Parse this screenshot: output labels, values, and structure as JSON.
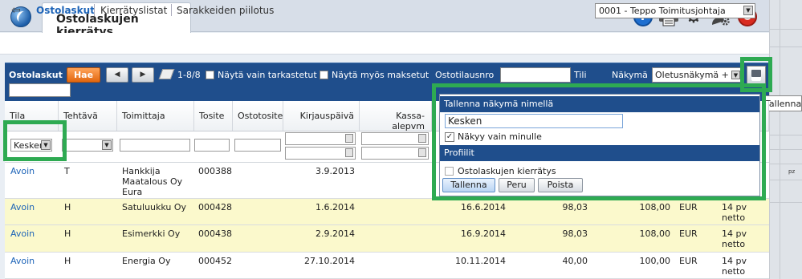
{
  "app": {
    "tab_title": "Ostolaskujen kierrätys",
    "help": "?",
    "power": "⏻"
  },
  "nav": {
    "links": [
      "Ostolaskut",
      "Kierrätyslistat",
      "Sarakkeiden piilotus"
    ],
    "user": "0001 - Teppo Toimitusjohtaja"
  },
  "toolbar": {
    "title": "Ostolaskut",
    "search_button": "Hae",
    "prev": "◀",
    "next": "▶",
    "range": "1-8/8",
    "check1": "Näytä vain tarkastetut",
    "check2": "Näytä myös maksetut",
    "order_label": "Ostotilausnro",
    "order_value": "",
    "tili_label": "Tili",
    "view_label": "Näkymä",
    "view_value": "Oletusnäkymä +",
    "save_tooltip": "Tallenna"
  },
  "table": {
    "headers": [
      "Tila",
      "Tehtävä",
      "Toimittaja",
      "Tosite",
      "Ostotosite",
      "Kirjauspäivä",
      "Kassa-alepvm"
    ],
    "filter_tila": "Kesken",
    "rows": [
      {
        "tila": "Avoin",
        "tehtava": "T",
        "toimittaja": [
          "Hankkija",
          "Maatalous Oy",
          "Eura"
        ],
        "tosite": "000388",
        "ostotosite": "",
        "kirjaus": "3.9.2013",
        "kassa": "",
        "erapvm": "",
        "summa1": "",
        "summa2": "",
        "valuutta": "",
        "ehto": []
      },
      {
        "tila": "Avoin",
        "tehtava": "H",
        "toimittaja": [
          "Satuluukku Oy"
        ],
        "tosite": "000428",
        "ostotosite": "",
        "kirjaus": "1.6.2014",
        "kassa": "",
        "erapvm": "16.6.2014",
        "summa1": "98,03",
        "summa2": "108,00",
        "valuutta": "EUR",
        "ehto": [
          "14 pv",
          "netto"
        ]
      },
      {
        "tila": "Avoin",
        "tehtava": "H",
        "toimittaja": [
          "Esimerkki Oy"
        ],
        "tosite": "000438",
        "ostotosite": "",
        "kirjaus": "2.9.2014",
        "kassa": "",
        "erapvm": "16.9.2014",
        "summa1": "98,03",
        "summa2": "108,00",
        "valuutta": "EUR",
        "ehto": [
          "14 pv",
          "netto"
        ]
      },
      {
        "tila": "Avoin",
        "tehtava": "H",
        "toimittaja": [
          "Energia Oy"
        ],
        "tosite": "000452",
        "ostotosite": "",
        "kirjaus": "27.10.2014",
        "kassa": "",
        "erapvm": "10.11.2014",
        "summa1": "40,00",
        "summa2": "100,00",
        "valuutta": "EUR",
        "ehto": [
          "14 pv",
          "netto"
        ]
      }
    ]
  },
  "popup": {
    "save_header": "Tallenna näkymä nimellä",
    "name_value": "Kesken",
    "only_me": "Näkyy vain minulle",
    "profiles_header": "Profiilit",
    "profile_item": "Ostolaskujen kierrätys",
    "btn_save": "Tallenna",
    "btn_cancel": "Peru",
    "btn_delete": "Poista"
  },
  "side": {
    "snippet1": "pz"
  },
  "colors": {
    "header_blue": "#1f4e8c",
    "highlight_green": "#2eaa52",
    "row_yellow": "#fbf9cc",
    "link_blue": "#1d64b8",
    "hae_orange": "#e2670f"
  }
}
